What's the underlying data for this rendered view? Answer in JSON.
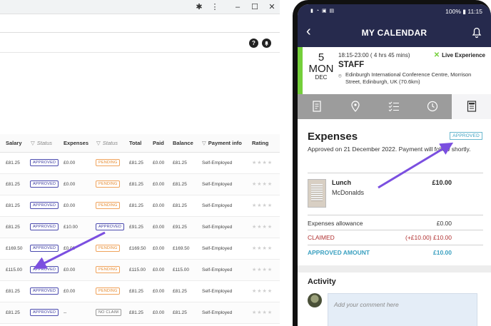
{
  "browser": {
    "table": {
      "headers": {
        "salary": "Salary",
        "status1": "Status",
        "expenses": "Expenses",
        "status2": "Status",
        "total": "Total",
        "paid": "Paid",
        "balance": "Balance",
        "payment_info": "Payment info",
        "rating": "Rating"
      },
      "rows": [
        {
          "salary": "£81.25",
          "status1": "APPROVED",
          "expenses": "£0.00",
          "status2": "PENDING",
          "total": "£81.25",
          "paid": "£0.00",
          "balance": "£81.25",
          "payment": "Self-Employed"
        },
        {
          "salary": "£81.25",
          "status1": "APPROVED",
          "expenses": "£0.00",
          "status2": "PENDING",
          "total": "£81.25",
          "paid": "£0.00",
          "balance": "£81.25",
          "payment": "Self-Employed"
        },
        {
          "salary": "£81.25",
          "status1": "APPROVED",
          "expenses": "£0.00",
          "status2": "PENDING",
          "total": "£81.25",
          "paid": "£0.00",
          "balance": "£81.25",
          "payment": "Self-Employed"
        },
        {
          "salary": "£81.25",
          "status1": "APPROVED",
          "expenses": "£10.00",
          "status2": "APPROVED",
          "total": "£91.25",
          "paid": "£0.00",
          "balance": "£91.25",
          "payment": "Self-Employed"
        },
        {
          "salary": "£169.50",
          "status1": "APPROVED",
          "expenses": "£0.00",
          "status2": "PENDING",
          "total": "£169.50",
          "paid": "£0.00",
          "balance": "£169.50",
          "payment": "Self-Employed"
        },
        {
          "salary": "£115.00",
          "status1": "APPROVED",
          "expenses": "£0.00",
          "status2": "PENDING",
          "total": "£115.00",
          "paid": "£0.00",
          "balance": "£115.00",
          "payment": "Self-Employed"
        },
        {
          "salary": "£81.25",
          "status1": "APPROVED",
          "expenses": "£0.00",
          "status2": "PENDING",
          "total": "£81.25",
          "paid": "£0.00",
          "balance": "£81.25",
          "payment": "Self-Employed"
        },
        {
          "salary": "£81.25",
          "status1": "APPROVED",
          "expenses": "--",
          "status2": "NO CLAIM",
          "total": "£81.25",
          "paid": "£0.00",
          "balance": "£81.25",
          "payment": "Self-Employed"
        }
      ]
    },
    "icons": {
      "help": "?",
      "notify": "bell-icon"
    }
  },
  "phone": {
    "status": {
      "battery": "100%",
      "time": "11:15"
    },
    "nav": {
      "title": "MY CALENDAR"
    },
    "event": {
      "day_num": "5",
      "day_name": "MON",
      "month": "DEC",
      "time": "18:15-23:00 ( 4 hrs 45 mins)",
      "brand": "Live Experience",
      "role": "STAFF",
      "location": "Edinburgh International Conference Centre, Morrison Street, Edinburgh, UK (70.6km)"
    },
    "expenses": {
      "title": "Expenses",
      "badge": "APPROVED",
      "note": "Approved on 21 December 2022. Payment will follow shortly.",
      "item_title": "Lunch",
      "item_vendor": "McDonalds",
      "item_amount": "£10.00",
      "allowance_label": "Expenses allowance",
      "allowance_value": "£0.00",
      "claimed_label": "CLAIMED",
      "claimed_value": "(+£10.00) £10.00",
      "approved_label": "APPROVED AMOUNT",
      "approved_value": "£10.00"
    },
    "activity": {
      "title": "Activity",
      "placeholder": "Add your comment here"
    }
  },
  "colors": {
    "navy": "#262a4d",
    "green": "#74cf3a",
    "approved_blue": "#3aa0c0",
    "arrow": "#7b4fe0"
  }
}
